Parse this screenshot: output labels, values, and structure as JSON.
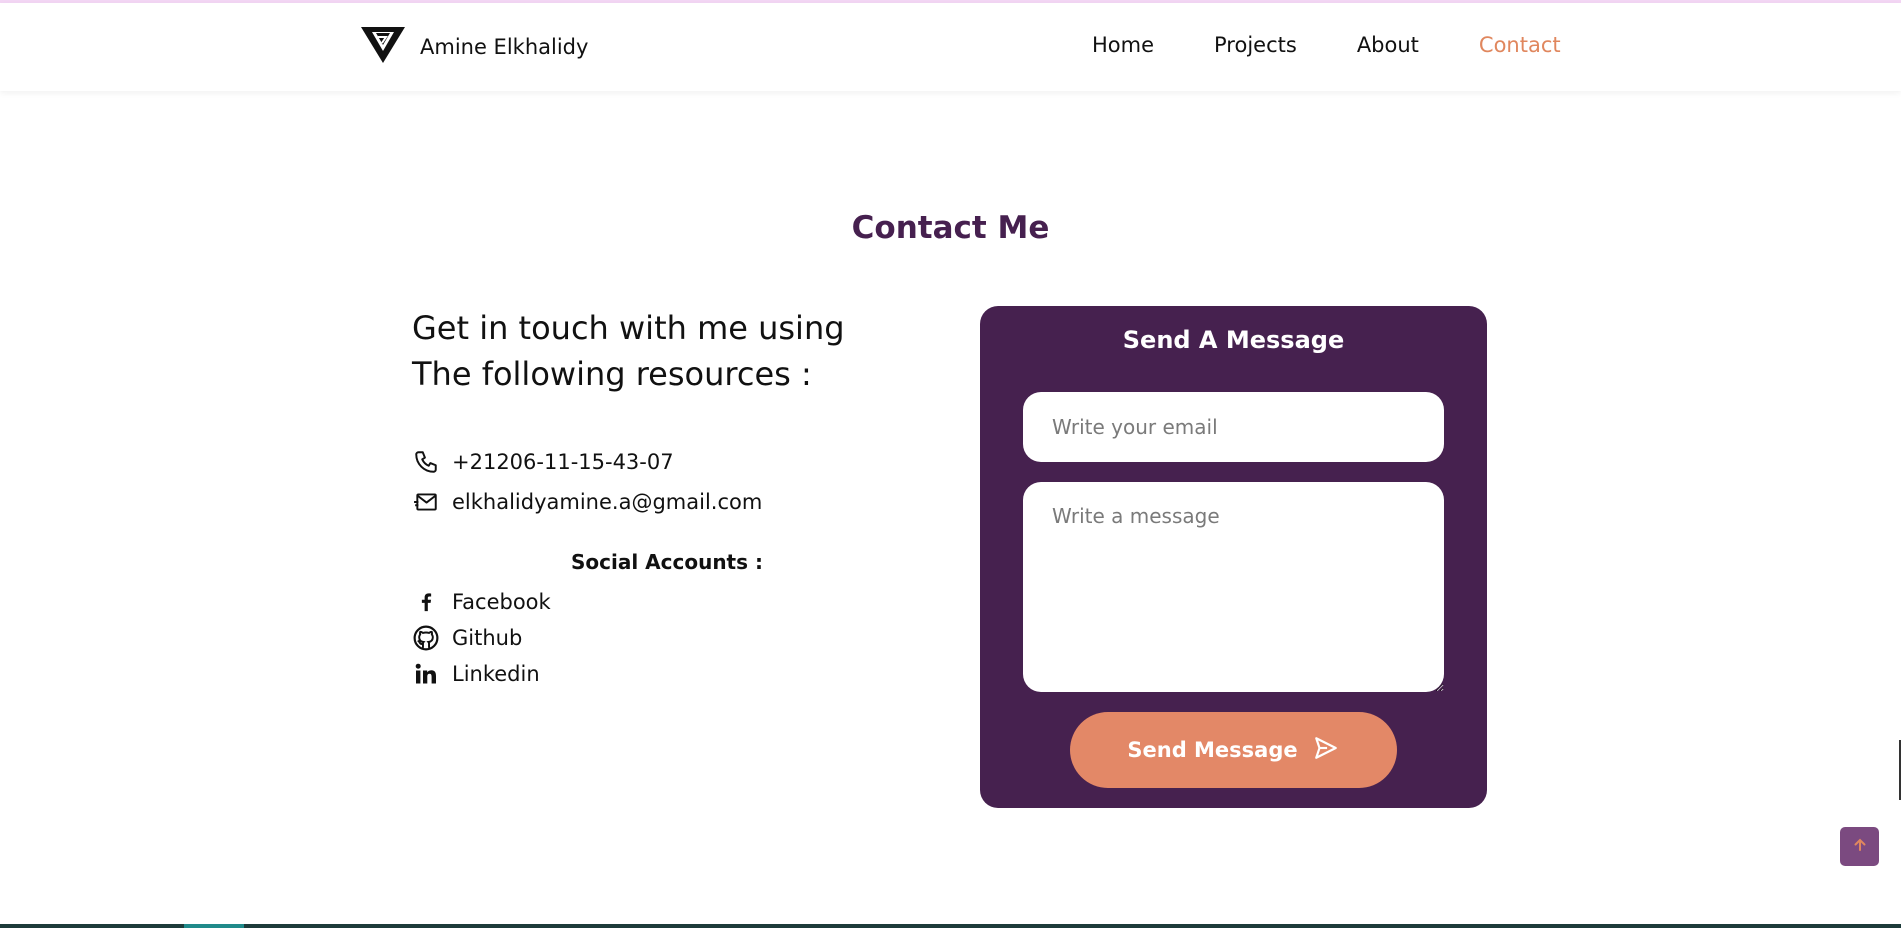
{
  "header": {
    "brand_name": "Amine Elkhalidy",
    "logo_icon": "triangle-monogram-logo",
    "nav": [
      {
        "label": "Home"
      },
      {
        "label": "Projects"
      },
      {
        "label": "About"
      },
      {
        "label": "Contact",
        "active": true
      }
    ]
  },
  "section": {
    "title": "Contact Me"
  },
  "info": {
    "intro_line1": "Get in touch with me using",
    "intro_line2": "The following resources :",
    "phone": {
      "icon": "phone-icon",
      "value": "+21206-11-15-43-07"
    },
    "email": {
      "icon": "envelope-icon",
      "value": "elkhalidyamine.a@gmail.com"
    },
    "social_title": "Social Accounts :",
    "socials": [
      {
        "icon": "facebook-icon",
        "label": "Facebook"
      },
      {
        "icon": "github-icon",
        "label": "Github"
      },
      {
        "icon": "linkedin-icon",
        "label": "Linkedin"
      }
    ]
  },
  "form": {
    "title": "Send A Message",
    "email_placeholder": "Write your email",
    "message_placeholder": "Write a message",
    "send_label": "Send Message",
    "send_icon": "send-icon"
  },
  "colors": {
    "accent": "#e0875e",
    "brand_purple": "#46204f",
    "button": "#e38867",
    "scroll_top_bg": "#7b4a80"
  },
  "scroll_top_icon": "arrow-up-icon"
}
